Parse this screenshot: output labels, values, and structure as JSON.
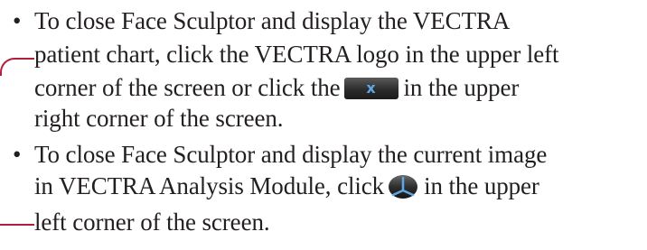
{
  "items": [
    {
      "lines": [
        "To close Face Sculptor and display the VECTRA",
        "patient chart, click the VECTRA logo in the upper left",
        "corner of the screen or click the",
        "in the upper",
        "right corner of the screen."
      ],
      "icon_name": "close-x-icon",
      "icon_label": "x"
    },
    {
      "lines": [
        "To close Face Sculptor and display the current image",
        "in VECTRA Analysis Module, click",
        "in the upper",
        "left corner of the screen."
      ],
      "icon_name": "analysis-module-icon"
    }
  ],
  "bullet_char": "•",
  "colors": {
    "text": "#231f20",
    "leader": "#b0203a"
  }
}
